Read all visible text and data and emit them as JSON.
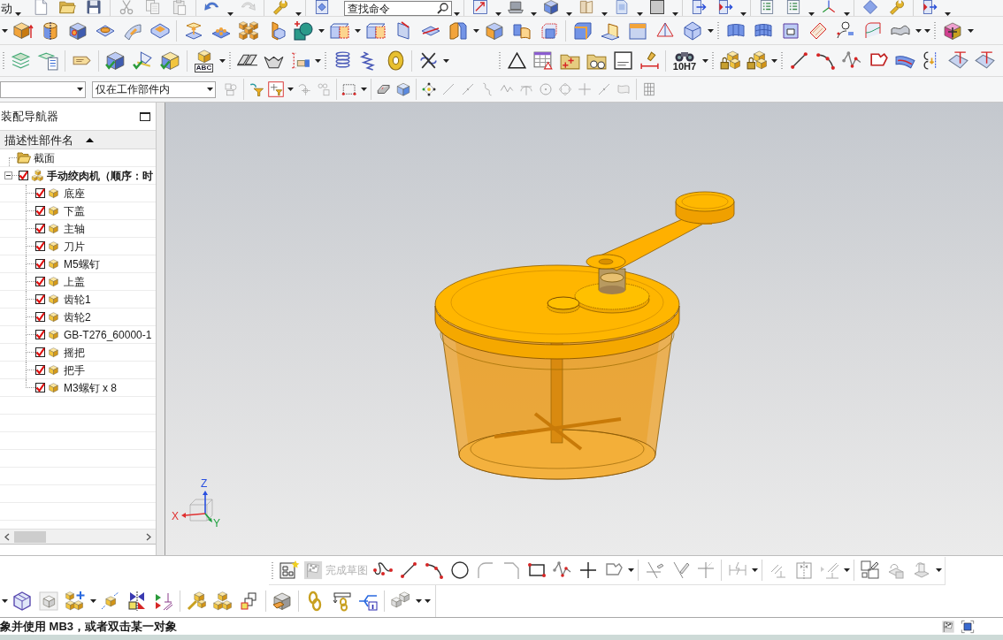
{
  "toolbar": {
    "start_menu": "动",
    "search": {
      "placeholder": "查找命令"
    },
    "text_icon_label": "ABC",
    "fit_label": "10H7",
    "selection_scope": "仅在工作部件内"
  },
  "navigator": {
    "title": "装配导航器",
    "column": {
      "label": "描述性部件名",
      "sort_ascending": true
    },
    "tree": [
      {
        "kind": "folder",
        "label": "截面"
      },
      {
        "kind": "assembly",
        "label": "手动绞肉机（顺序：时",
        "checked": true,
        "expanded": true,
        "children": [
          {
            "kind": "component",
            "label": "底座",
            "checked": true
          },
          {
            "kind": "component",
            "label": "下盖",
            "checked": true
          },
          {
            "kind": "component",
            "label": "主轴",
            "checked": true
          },
          {
            "kind": "component",
            "label": "刀片",
            "checked": true
          },
          {
            "kind": "component",
            "label": "M5螺钉",
            "checked": true
          },
          {
            "kind": "component",
            "label": "上盖",
            "checked": true
          },
          {
            "kind": "component",
            "label": "齿轮1",
            "checked": true
          },
          {
            "kind": "component",
            "label": "齿轮2",
            "checked": true
          },
          {
            "kind": "component",
            "label": "GB-T276_60000-1",
            "checked": true
          },
          {
            "kind": "component",
            "label": "摇把",
            "checked": true
          },
          {
            "kind": "component",
            "label": "把手",
            "checked": true
          },
          {
            "kind": "component",
            "label": "M3螺钉 x 8",
            "checked": true
          }
        ]
      }
    ]
  },
  "viewport": {
    "triad": {
      "x": "X",
      "y": "Y",
      "z": "Z"
    }
  },
  "sketch_toolbar": {
    "finish": {
      "label": "完成草图",
      "disabled": true
    }
  },
  "status_bar": {
    "message": "象并使用 MB3，或者双击某一对象"
  }
}
